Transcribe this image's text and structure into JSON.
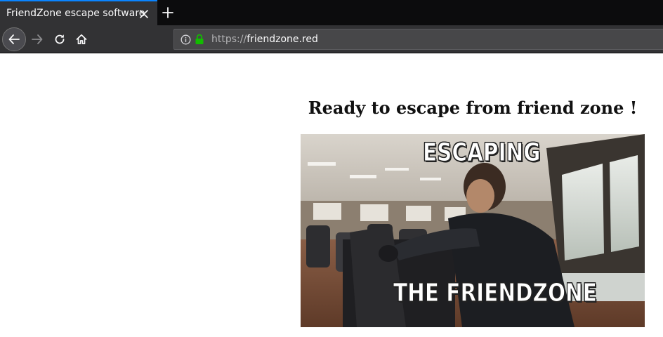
{
  "browser": {
    "tab": {
      "title": "FriendZone escape software"
    },
    "address": {
      "scheme": "https://",
      "host": "friendzone.red"
    },
    "icons": {
      "tab_close": "close-icon",
      "new_tab": "plus-icon",
      "back": "arrow-left-icon",
      "forward": "arrow-right-icon",
      "reload": "reload-icon",
      "home": "home-icon",
      "info": "info-icon",
      "lock": "lock-icon"
    },
    "colors": {
      "tab_accent": "#0a84ff",
      "lock": "#12bc00",
      "chrome": "#323234"
    }
  },
  "page": {
    "heading": "Ready to escape from friend zone !",
    "meme": {
      "top_text": "ESCAPING",
      "bottom_text": "THE FRIENDZONE"
    }
  }
}
